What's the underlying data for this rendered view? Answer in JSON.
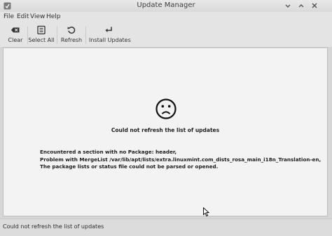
{
  "window": {
    "title": "Update Manager",
    "icon": "app-icon",
    "controls": [
      "minimize-icon",
      "maximize-icon",
      "close-icon"
    ]
  },
  "menubar": {
    "items": [
      "File",
      "Edit",
      "View",
      "Help"
    ]
  },
  "toolbar": {
    "buttons": [
      {
        "label": "Clear",
        "icon": "clear-icon"
      },
      {
        "label": "Select All",
        "icon": "select-all-icon"
      },
      {
        "label": "Refresh",
        "icon": "refresh-icon"
      },
      {
        "label": "Install Updates",
        "icon": "install-icon"
      }
    ]
  },
  "main": {
    "icon": "sad-face-icon",
    "error_title": "Could not refresh the list of updates",
    "error_lines": [
      "Encountered a section with no Package: header,",
      "Problem with MergeList /var/lib/apt/lists/extra.linuxmint.com_dists_rosa_main_i18n_Translation-en,",
      "The package lists or status file could not be parsed or opened."
    ]
  },
  "statusbar": {
    "text": "Could not refresh the list of updates"
  },
  "colors": {
    "window_bg": "#d6d6d6",
    "content_bg": "#f3f3f3",
    "text": "#2b2b2b"
  }
}
